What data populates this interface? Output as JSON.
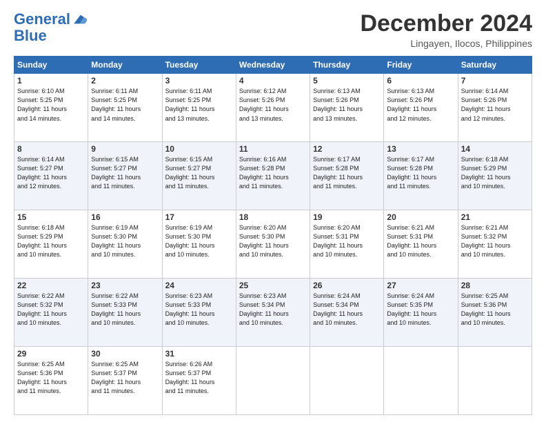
{
  "logo": {
    "line1": "General",
    "line2": "Blue"
  },
  "header": {
    "month": "December 2024",
    "location": "Lingayen, Ilocos, Philippines"
  },
  "weekdays": [
    "Sunday",
    "Monday",
    "Tuesday",
    "Wednesday",
    "Thursday",
    "Friday",
    "Saturday"
  ],
  "weeks": [
    [
      {
        "day": "1",
        "info": "Sunrise: 6:10 AM\nSunset: 5:25 PM\nDaylight: 11 hours\nand 14 minutes."
      },
      {
        "day": "2",
        "info": "Sunrise: 6:11 AM\nSunset: 5:25 PM\nDaylight: 11 hours\nand 14 minutes."
      },
      {
        "day": "3",
        "info": "Sunrise: 6:11 AM\nSunset: 5:25 PM\nDaylight: 11 hours\nand 13 minutes."
      },
      {
        "day": "4",
        "info": "Sunrise: 6:12 AM\nSunset: 5:26 PM\nDaylight: 11 hours\nand 13 minutes."
      },
      {
        "day": "5",
        "info": "Sunrise: 6:13 AM\nSunset: 5:26 PM\nDaylight: 11 hours\nand 13 minutes."
      },
      {
        "day": "6",
        "info": "Sunrise: 6:13 AM\nSunset: 5:26 PM\nDaylight: 11 hours\nand 12 minutes."
      },
      {
        "day": "7",
        "info": "Sunrise: 6:14 AM\nSunset: 5:26 PM\nDaylight: 11 hours\nand 12 minutes."
      }
    ],
    [
      {
        "day": "8",
        "info": "Sunrise: 6:14 AM\nSunset: 5:27 PM\nDaylight: 11 hours\nand 12 minutes."
      },
      {
        "day": "9",
        "info": "Sunrise: 6:15 AM\nSunset: 5:27 PM\nDaylight: 11 hours\nand 11 minutes."
      },
      {
        "day": "10",
        "info": "Sunrise: 6:15 AM\nSunset: 5:27 PM\nDaylight: 11 hours\nand 11 minutes."
      },
      {
        "day": "11",
        "info": "Sunrise: 6:16 AM\nSunset: 5:28 PM\nDaylight: 11 hours\nand 11 minutes."
      },
      {
        "day": "12",
        "info": "Sunrise: 6:17 AM\nSunset: 5:28 PM\nDaylight: 11 hours\nand 11 minutes."
      },
      {
        "day": "13",
        "info": "Sunrise: 6:17 AM\nSunset: 5:28 PM\nDaylight: 11 hours\nand 11 minutes."
      },
      {
        "day": "14",
        "info": "Sunrise: 6:18 AM\nSunset: 5:29 PM\nDaylight: 11 hours\nand 10 minutes."
      }
    ],
    [
      {
        "day": "15",
        "info": "Sunrise: 6:18 AM\nSunset: 5:29 PM\nDaylight: 11 hours\nand 10 minutes."
      },
      {
        "day": "16",
        "info": "Sunrise: 6:19 AM\nSunset: 5:30 PM\nDaylight: 11 hours\nand 10 minutes."
      },
      {
        "day": "17",
        "info": "Sunrise: 6:19 AM\nSunset: 5:30 PM\nDaylight: 11 hours\nand 10 minutes."
      },
      {
        "day": "18",
        "info": "Sunrise: 6:20 AM\nSunset: 5:30 PM\nDaylight: 11 hours\nand 10 minutes."
      },
      {
        "day": "19",
        "info": "Sunrise: 6:20 AM\nSunset: 5:31 PM\nDaylight: 11 hours\nand 10 minutes."
      },
      {
        "day": "20",
        "info": "Sunrise: 6:21 AM\nSunset: 5:31 PM\nDaylight: 11 hours\nand 10 minutes."
      },
      {
        "day": "21",
        "info": "Sunrise: 6:21 AM\nSunset: 5:32 PM\nDaylight: 11 hours\nand 10 minutes."
      }
    ],
    [
      {
        "day": "22",
        "info": "Sunrise: 6:22 AM\nSunset: 5:32 PM\nDaylight: 11 hours\nand 10 minutes."
      },
      {
        "day": "23",
        "info": "Sunrise: 6:22 AM\nSunset: 5:33 PM\nDaylight: 11 hours\nand 10 minutes."
      },
      {
        "day": "24",
        "info": "Sunrise: 6:23 AM\nSunset: 5:33 PM\nDaylight: 11 hours\nand 10 minutes."
      },
      {
        "day": "25",
        "info": "Sunrise: 6:23 AM\nSunset: 5:34 PM\nDaylight: 11 hours\nand 10 minutes."
      },
      {
        "day": "26",
        "info": "Sunrise: 6:24 AM\nSunset: 5:34 PM\nDaylight: 11 hours\nand 10 minutes."
      },
      {
        "day": "27",
        "info": "Sunrise: 6:24 AM\nSunset: 5:35 PM\nDaylight: 11 hours\nand 10 minutes."
      },
      {
        "day": "28",
        "info": "Sunrise: 6:25 AM\nSunset: 5:36 PM\nDaylight: 11 hours\nand 10 minutes."
      }
    ],
    [
      {
        "day": "29",
        "info": "Sunrise: 6:25 AM\nSunset: 5:36 PM\nDaylight: 11 hours\nand 11 minutes."
      },
      {
        "day": "30",
        "info": "Sunrise: 6:25 AM\nSunset: 5:37 PM\nDaylight: 11 hours\nand 11 minutes."
      },
      {
        "day": "31",
        "info": "Sunrise: 6:26 AM\nSunset: 5:37 PM\nDaylight: 11 hours\nand 11 minutes."
      },
      null,
      null,
      null,
      null
    ]
  ]
}
